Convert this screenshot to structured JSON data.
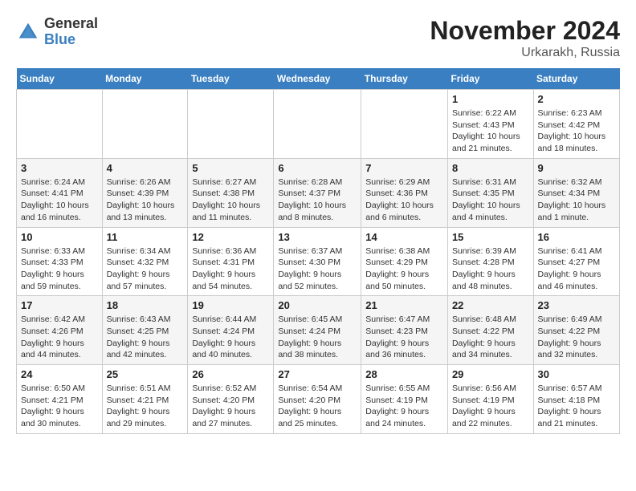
{
  "header": {
    "logo_general": "General",
    "logo_blue": "Blue",
    "month": "November 2024",
    "location": "Urkarakh, Russia"
  },
  "weekdays": [
    "Sunday",
    "Monday",
    "Tuesday",
    "Wednesday",
    "Thursday",
    "Friday",
    "Saturday"
  ],
  "weeks": [
    [
      {
        "day": "",
        "info": ""
      },
      {
        "day": "",
        "info": ""
      },
      {
        "day": "",
        "info": ""
      },
      {
        "day": "",
        "info": ""
      },
      {
        "day": "",
        "info": ""
      },
      {
        "day": "1",
        "info": "Sunrise: 6:22 AM\nSunset: 4:43 PM\nDaylight: 10 hours\nand 21 minutes."
      },
      {
        "day": "2",
        "info": "Sunrise: 6:23 AM\nSunset: 4:42 PM\nDaylight: 10 hours\nand 18 minutes."
      }
    ],
    [
      {
        "day": "3",
        "info": "Sunrise: 6:24 AM\nSunset: 4:41 PM\nDaylight: 10 hours\nand 16 minutes."
      },
      {
        "day": "4",
        "info": "Sunrise: 6:26 AM\nSunset: 4:39 PM\nDaylight: 10 hours\nand 13 minutes."
      },
      {
        "day": "5",
        "info": "Sunrise: 6:27 AM\nSunset: 4:38 PM\nDaylight: 10 hours\nand 11 minutes."
      },
      {
        "day": "6",
        "info": "Sunrise: 6:28 AM\nSunset: 4:37 PM\nDaylight: 10 hours\nand 8 minutes."
      },
      {
        "day": "7",
        "info": "Sunrise: 6:29 AM\nSunset: 4:36 PM\nDaylight: 10 hours\nand 6 minutes."
      },
      {
        "day": "8",
        "info": "Sunrise: 6:31 AM\nSunset: 4:35 PM\nDaylight: 10 hours\nand 4 minutes."
      },
      {
        "day": "9",
        "info": "Sunrise: 6:32 AM\nSunset: 4:34 PM\nDaylight: 10 hours\nand 1 minute."
      }
    ],
    [
      {
        "day": "10",
        "info": "Sunrise: 6:33 AM\nSunset: 4:33 PM\nDaylight: 9 hours\nand 59 minutes."
      },
      {
        "day": "11",
        "info": "Sunrise: 6:34 AM\nSunset: 4:32 PM\nDaylight: 9 hours\nand 57 minutes."
      },
      {
        "day": "12",
        "info": "Sunrise: 6:36 AM\nSunset: 4:31 PM\nDaylight: 9 hours\nand 54 minutes."
      },
      {
        "day": "13",
        "info": "Sunrise: 6:37 AM\nSunset: 4:30 PM\nDaylight: 9 hours\nand 52 minutes."
      },
      {
        "day": "14",
        "info": "Sunrise: 6:38 AM\nSunset: 4:29 PM\nDaylight: 9 hours\nand 50 minutes."
      },
      {
        "day": "15",
        "info": "Sunrise: 6:39 AM\nSunset: 4:28 PM\nDaylight: 9 hours\nand 48 minutes."
      },
      {
        "day": "16",
        "info": "Sunrise: 6:41 AM\nSunset: 4:27 PM\nDaylight: 9 hours\nand 46 minutes."
      }
    ],
    [
      {
        "day": "17",
        "info": "Sunrise: 6:42 AM\nSunset: 4:26 PM\nDaylight: 9 hours\nand 44 minutes."
      },
      {
        "day": "18",
        "info": "Sunrise: 6:43 AM\nSunset: 4:25 PM\nDaylight: 9 hours\nand 42 minutes."
      },
      {
        "day": "19",
        "info": "Sunrise: 6:44 AM\nSunset: 4:24 PM\nDaylight: 9 hours\nand 40 minutes."
      },
      {
        "day": "20",
        "info": "Sunrise: 6:45 AM\nSunset: 4:24 PM\nDaylight: 9 hours\nand 38 minutes."
      },
      {
        "day": "21",
        "info": "Sunrise: 6:47 AM\nSunset: 4:23 PM\nDaylight: 9 hours\nand 36 minutes."
      },
      {
        "day": "22",
        "info": "Sunrise: 6:48 AM\nSunset: 4:22 PM\nDaylight: 9 hours\nand 34 minutes."
      },
      {
        "day": "23",
        "info": "Sunrise: 6:49 AM\nSunset: 4:22 PM\nDaylight: 9 hours\nand 32 minutes."
      }
    ],
    [
      {
        "day": "24",
        "info": "Sunrise: 6:50 AM\nSunset: 4:21 PM\nDaylight: 9 hours\nand 30 minutes."
      },
      {
        "day": "25",
        "info": "Sunrise: 6:51 AM\nSunset: 4:21 PM\nDaylight: 9 hours\nand 29 minutes."
      },
      {
        "day": "26",
        "info": "Sunrise: 6:52 AM\nSunset: 4:20 PM\nDaylight: 9 hours\nand 27 minutes."
      },
      {
        "day": "27",
        "info": "Sunrise: 6:54 AM\nSunset: 4:20 PM\nDaylight: 9 hours\nand 25 minutes."
      },
      {
        "day": "28",
        "info": "Sunrise: 6:55 AM\nSunset: 4:19 PM\nDaylight: 9 hours\nand 24 minutes."
      },
      {
        "day": "29",
        "info": "Sunrise: 6:56 AM\nSunset: 4:19 PM\nDaylight: 9 hours\nand 22 minutes."
      },
      {
        "day": "30",
        "info": "Sunrise: 6:57 AM\nSunset: 4:18 PM\nDaylight: 9 hours\nand 21 minutes."
      }
    ]
  ]
}
